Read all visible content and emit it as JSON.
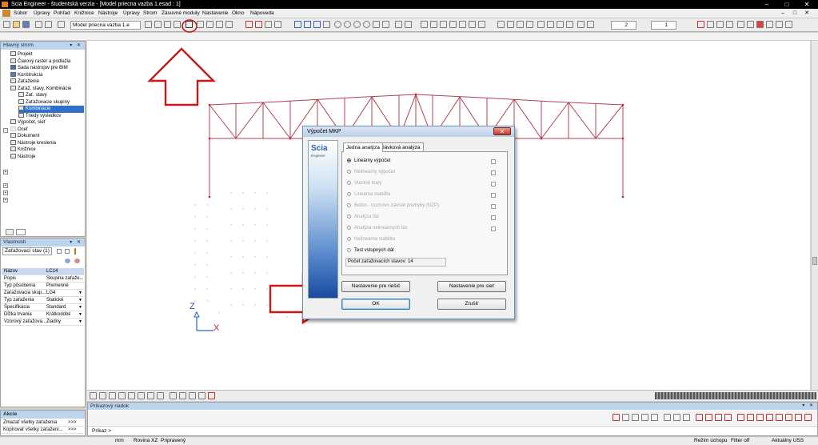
{
  "window": {
    "title": "Scia Engineer - študentská verzia - [Model priecna vazba 1.esad : 1]",
    "controls": [
      "–",
      "□",
      "✕"
    ]
  },
  "menu": {
    "items": [
      "Súbor",
      "Úpravy",
      "Pohľad",
      "Knižnice",
      "Nástroje",
      "Úpravy",
      "Strom",
      "Zásuvné moduly",
      "Nastavenie",
      "Okno",
      "Nápoveda"
    ]
  },
  "toolbar": {
    "model_selector": "Model priecna vazba 1.e",
    "spin1": "2",
    "spin2": "1"
  },
  "main_tree": {
    "title": "Hlavný strom",
    "items": [
      {
        "label": "Projekt",
        "icon": "project-icon"
      },
      {
        "label": "Čiarový raster a podlažia",
        "icon": "grid-icon"
      },
      {
        "label": "Sada nástrojov pre BIM",
        "icon": "bim-icon"
      },
      {
        "label": "Konštrukcia",
        "icon": "structure-icon"
      },
      {
        "label": "Zaťaženie",
        "icon": "load-icon"
      },
      {
        "label": "Zaťaž. stavy, Kombinácie",
        "icon": "loadcase-icon"
      },
      {
        "label": "Zať. stavy",
        "icon": "loadcase-icon"
      },
      {
        "label": "Zaťažovacie skupiny",
        "icon": "group-icon"
      },
      {
        "label": "Kombinácie",
        "icon": "combination-icon"
      },
      {
        "label": "Triedy výsledkov",
        "icon": "class-icon"
      },
      {
        "label": "Výpočet, sieť",
        "icon": "calc-icon"
      },
      {
        "label": "Oceľ",
        "icon": "steel-icon"
      },
      {
        "label": "Dokument",
        "icon": "document-icon"
      },
      {
        "label": "Nástroje kreslenia",
        "icon": "drawing-icon"
      },
      {
        "label": "Knižnice",
        "icon": "library-icon"
      },
      {
        "label": "Nástroje",
        "icon": "tools-icon"
      }
    ]
  },
  "properties": {
    "title": "Vlastnosti",
    "selector": "Zaťažovací stav (1)",
    "rows": [
      {
        "key": "Názov",
        "value": "LC14"
      },
      {
        "key": "Popis",
        "value": "Skupina zaťaže..."
      },
      {
        "key": "Typ pôsobenia",
        "value": "Premenné"
      },
      {
        "key": "Zaťažovacia skup...",
        "value": "LG4"
      },
      {
        "key": "Typ zaťaženia",
        "value": "Statické"
      },
      {
        "key": "Špecifikácia",
        "value": "Štandard"
      },
      {
        "key": "Dĺžka trvania",
        "value": "Krátkodobé"
      },
      {
        "key": "Vzorový zaťažova...",
        "value": "Žiadny"
      }
    ]
  },
  "actions": {
    "title": "Akcie",
    "rows": [
      {
        "label": "Zmazať všetky zaťaženia",
        "btn": ">>>"
      },
      {
        "label": "Kopírovať všetky zaťaženi...",
        "btn": ">>>"
      }
    ]
  },
  "dialog": {
    "title": "Výpočet MKP",
    "logo": "Scia",
    "logo_sub": "Engineer",
    "tabs": [
      "Jedna analýza",
      "Dávková analýza"
    ],
    "options": [
      {
        "label": "Lineárny výpočet",
        "enabled": true,
        "selected": true
      },
      {
        "label": "Nelineárny výpočet",
        "enabled": false
      },
      {
        "label": "Vlastné tvary",
        "enabled": false
      },
      {
        "label": "Lineárna stabilita",
        "enabled": false
      },
      {
        "label": "Betón - rozmovo závislé priehyby (NZP)",
        "enabled": false
      },
      {
        "label": "Analýza fáz",
        "enabled": false
      },
      {
        "label": "Analýza nelineárnych fáz",
        "enabled": false
      },
      {
        "label": "Nelineárna stabilita",
        "enabled": false
      },
      {
        "label": "Test vstupných dát",
        "enabled": true,
        "selected": false
      }
    ],
    "count_label": "Počet zaťažovacích stavov: 14",
    "btn_mesh": "Nastavenie pre riešič",
    "btn_solver": "Nastavenie pre sieť",
    "btn_ok": "OK",
    "btn_cancel": "Zrušiť"
  },
  "axes": {
    "z": "Z",
    "x": "X"
  },
  "command": {
    "title": "Príkazový riadok",
    "prompt": "Príkaz >"
  },
  "status": {
    "units": "mm",
    "plane": "Rovina XZ",
    "state": "Pripravený",
    "mode": "Režim úchopu",
    "filter": "Filter off",
    "uss": "Aktuálny USS"
  }
}
